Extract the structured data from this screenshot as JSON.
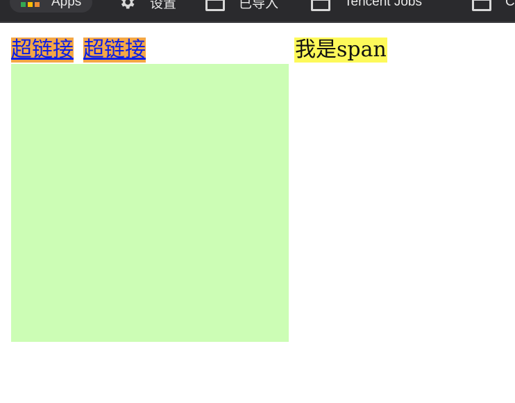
{
  "bookmarks_bar": {
    "items": [
      {
        "label": "Apps",
        "icon": "apps-grid-icon"
      },
      {
        "label": "设置",
        "icon": "gear-icon"
      },
      {
        "label": "已导入",
        "icon": "folder-icon"
      },
      {
        "label": "Tencent Jobs",
        "icon": "folder-icon"
      },
      {
        "label": "C",
        "icon": "folder-icon"
      }
    ]
  },
  "page": {
    "links": [
      {
        "label": "超链接"
      },
      {
        "label": "超链接"
      }
    ],
    "span_text": "我是span"
  },
  "colors": {
    "link_background": "#f4a745",
    "link_text": "#0b1ee6",
    "span_background": "#fdf95a",
    "block_background": "#ccfdb5",
    "toolbar_background": "#2a2a2d"
  }
}
